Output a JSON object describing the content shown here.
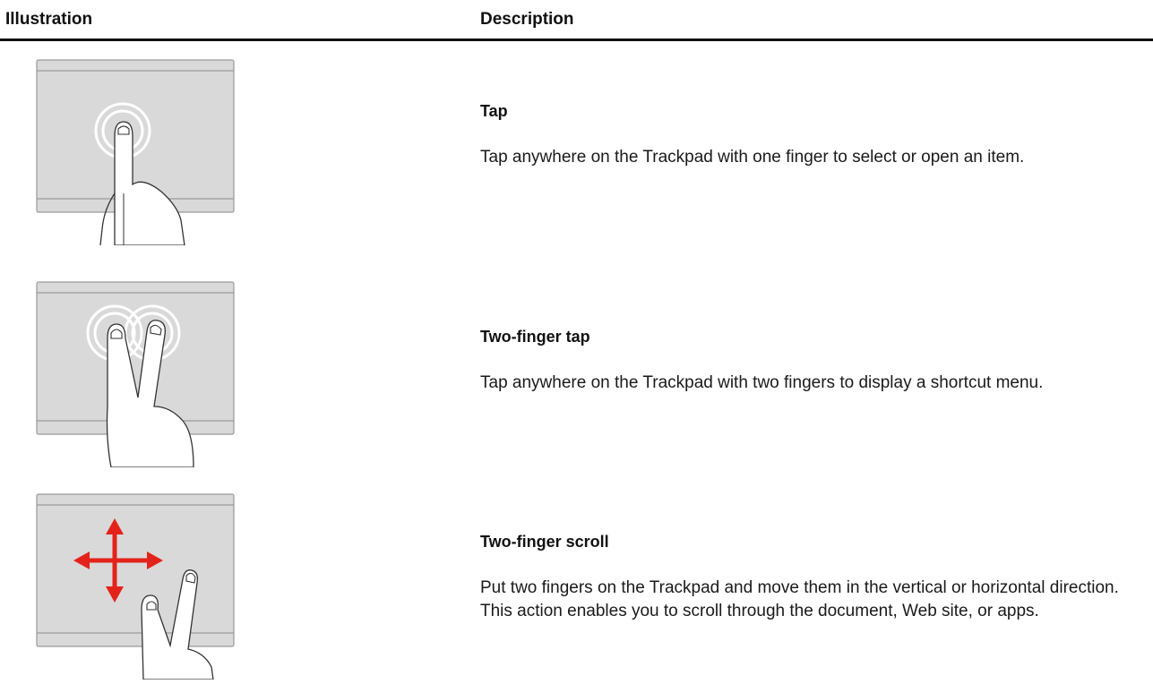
{
  "table": {
    "headers": {
      "illustration": "Illustration",
      "description": "Description"
    },
    "rows": [
      {
        "gesture": "tap",
        "title": "Tap",
        "description": "Tap anywhere on the Trackpad with one finger to select or open an item."
      },
      {
        "gesture": "two-finger-tap",
        "title": "Two-finger tap",
        "description": "Tap anywhere on the Trackpad with two fingers to display a shortcut menu."
      },
      {
        "gesture": "two-finger-scroll",
        "title": "Two-finger scroll",
        "description": "Put two fingers on the Trackpad and move them in the vertical or horizontal direction. This action enables you to scroll through the document, Web site, or apps."
      }
    ]
  },
  "colors": {
    "pad": "#d9d9d9",
    "pad_edge": "#a6a6a6",
    "arrow": "#e3231b",
    "rule": "#111111"
  }
}
